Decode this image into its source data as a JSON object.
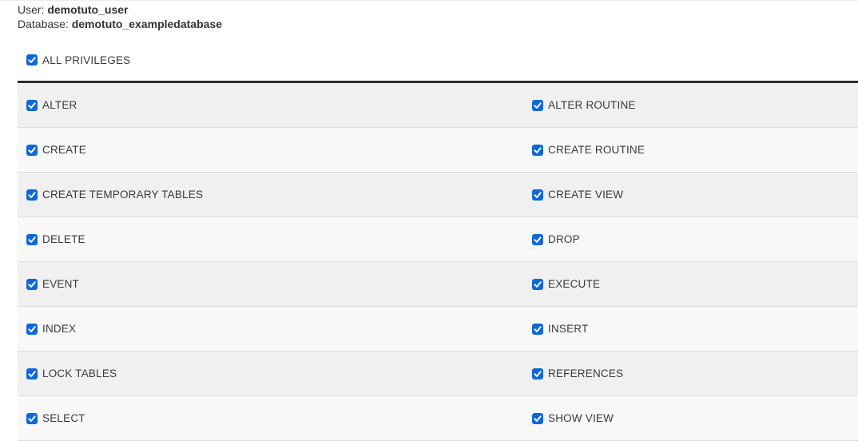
{
  "header": {
    "user_label": "User:",
    "user_value": "demotuto_user",
    "database_label": "Database:",
    "database_value": "demotuto_exampledatabase"
  },
  "all_privileges": {
    "label": "ALL PRIVILEGES",
    "checked": true
  },
  "privileges": {
    "rows": [
      {
        "left": {
          "label": "ALTER",
          "checked": true
        },
        "right": {
          "label": "ALTER ROUTINE",
          "checked": true
        }
      },
      {
        "left": {
          "label": "CREATE",
          "checked": true
        },
        "right": {
          "label": "CREATE ROUTINE",
          "checked": true
        }
      },
      {
        "left": {
          "label": "CREATE TEMPORARY TABLES",
          "checked": true
        },
        "right": {
          "label": "CREATE VIEW",
          "checked": true
        }
      },
      {
        "left": {
          "label": "DELETE",
          "checked": true
        },
        "right": {
          "label": "DROP",
          "checked": true
        }
      },
      {
        "left": {
          "label": "EVENT",
          "checked": true
        },
        "right": {
          "label": "EXECUTE",
          "checked": true
        }
      },
      {
        "left": {
          "label": "INDEX",
          "checked": true
        },
        "right": {
          "label": "INSERT",
          "checked": true
        }
      },
      {
        "left": {
          "label": "LOCK TABLES",
          "checked": true
        },
        "right": {
          "label": "REFERENCES",
          "checked": true
        }
      },
      {
        "left": {
          "label": "SELECT",
          "checked": true
        },
        "right": {
          "label": "SHOW VIEW",
          "checked": true
        }
      }
    ]
  },
  "icons": {
    "checkbox_check": "check-icon"
  },
  "colors": {
    "accent": "#0e68d8",
    "row_odd": "#f0f0f1",
    "row_even": "#f8f8f9",
    "row_border": "#dcdcdc",
    "divider": "#2d2d2d",
    "text": "#383838",
    "top_border": "#ececec"
  }
}
